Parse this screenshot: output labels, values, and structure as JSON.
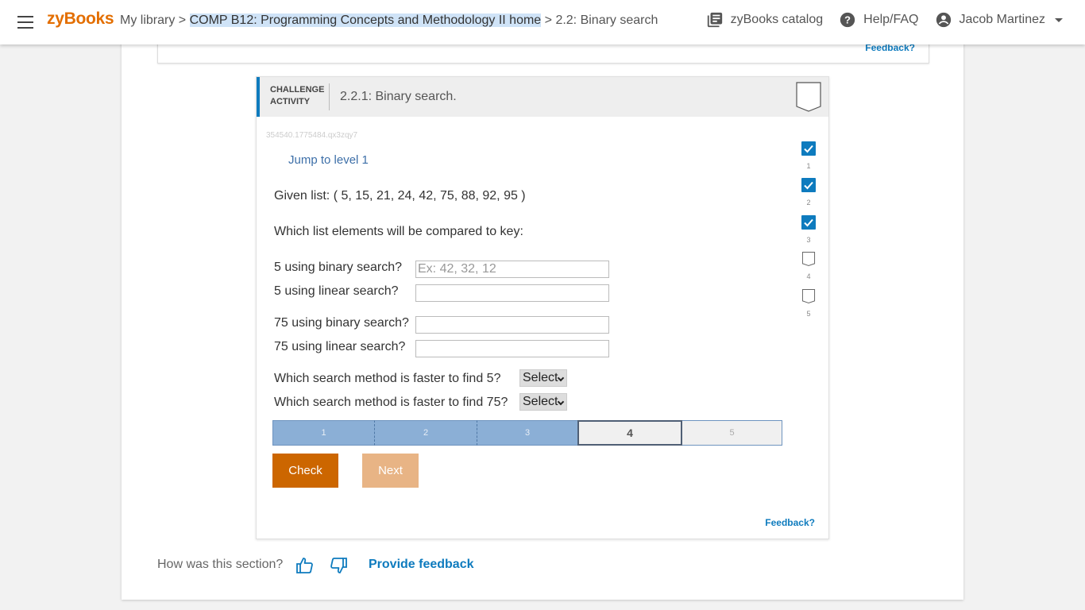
{
  "header": {
    "logo": "zyBooks",
    "breadcrumb": {
      "library": "My library",
      "sep1": ">",
      "course": "COMP B12: Programming Concepts and Methodology II home",
      "sep2": ">",
      "section": "2.2: Binary search"
    },
    "catalog": "zyBooks catalog",
    "help": "Help/FAQ",
    "user": "Jacob Martinez"
  },
  "prev_card": {
    "feedback": "Feedback?"
  },
  "activity": {
    "type_line1": "CHALLENGE",
    "type_line2": "ACTIVITY",
    "title": "2.2.1: Binary search.",
    "id": "354540.1775484.qx3zqy7",
    "jump": "Jump to level 1",
    "given": "Given list: ( 5, 15, 21, 24, 42, 75, 88, 92, 95 )",
    "which": "Which list elements will be compared to key:",
    "questions": [
      {
        "label": "5 using binary search?",
        "placeholder": "Ex: 42, 32, 12",
        "value": ""
      },
      {
        "label": "5 using linear search?",
        "placeholder": "",
        "value": ""
      },
      {
        "label": "75 using binary search?",
        "placeholder": "",
        "value": ""
      },
      {
        "label": "75 using linear search?",
        "placeholder": "",
        "value": ""
      }
    ],
    "selects": [
      {
        "label": "Which search method is faster to find 5?",
        "value": "Select"
      },
      {
        "label": "Which search method is faster to find 75?",
        "value": "Select"
      }
    ],
    "levels": [
      "1",
      "2",
      "3",
      "4",
      "5"
    ],
    "current_level": 4,
    "check_label": "Check",
    "next_label": "Next",
    "feedback": "Feedback?",
    "level_checks": [
      {
        "num": "1",
        "done": true
      },
      {
        "num": "2",
        "done": true
      },
      {
        "num": "3",
        "done": true
      },
      {
        "num": "4",
        "done": false
      },
      {
        "num": "5",
        "done": false
      }
    ]
  },
  "footer": {
    "rate": "How was this section?",
    "thumbs_up": "thumbs-up-icon",
    "thumbs_down": "thumbs-down-icon",
    "provide": "Provide feedback"
  },
  "colors": {
    "brand": "#e36e00",
    "accent": "#0e7bbe",
    "check_button": "#cc6600",
    "next_button": "#e8b485",
    "level_done": "#8bafd6"
  }
}
